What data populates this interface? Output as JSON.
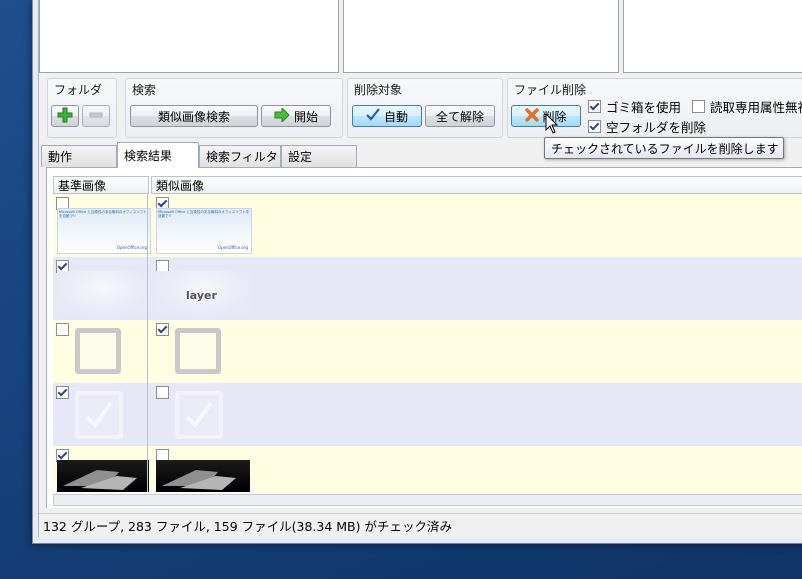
{
  "groups": {
    "folder": {
      "label": "フォルダ"
    },
    "search": {
      "label": "検索",
      "similar_button": "類似画像検索",
      "start_button": "開始"
    },
    "delete_target": {
      "label": "削除対象",
      "auto_button": "自動",
      "clear_button": "全て解除"
    },
    "file_delete": {
      "label": "ファイル削除",
      "delete_button": "削除",
      "recycle_option": "ゴミ箱を使用",
      "readonly_option": "読取専用属性無視",
      "empty_folder_option": "空フォルダを削除"
    }
  },
  "tooltip": "チェックされているファイルを削除します",
  "tabs": [
    {
      "label": "動作"
    },
    {
      "label": "検索結果"
    },
    {
      "label": "検索フィルタ"
    },
    {
      "label": "設定"
    }
  ],
  "columns": {
    "base": "基準画像",
    "similar": "類似画像"
  },
  "thumb_texts": {
    "office_heading": "Microsoft Office と互換性のある無料のオフィスソフトを自動で!!",
    "office_brand": "OpenOffice.org",
    "layer_text": "layer"
  },
  "rows": [
    {
      "base_checked": false,
      "similar_checked": true
    },
    {
      "base_checked": true,
      "similar_checked": false
    },
    {
      "base_checked": false,
      "similar_checked": true
    },
    {
      "base_checked": true,
      "similar_checked": false
    },
    {
      "base_checked": true,
      "similar_checked": false
    }
  ],
  "status": "132 グループ, 283 ファイル, 159 ファイル(38.34 MB) がチェック済み",
  "colors": {
    "accent": "#3c7fb1",
    "row_yellow": "#fffee3",
    "row_blue": "#e6e7f7",
    "desktop": "#1a4888"
  }
}
